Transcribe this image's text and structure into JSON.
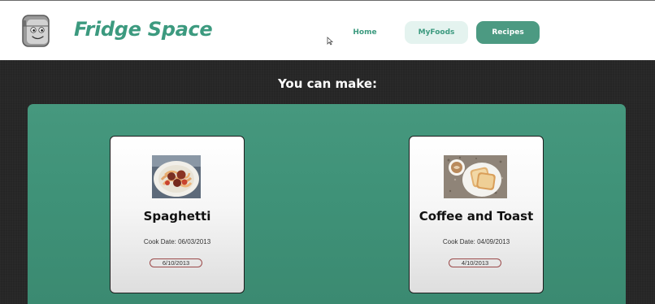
{
  "header": {
    "brand": "Fridge Space",
    "logo_icon": "fridge-mascot-icon",
    "nav": {
      "home": "Home",
      "myfoods": "MyFoods",
      "recipes": "Recipes"
    }
  },
  "main": {
    "headline": "You can make:"
  },
  "recipes": [
    {
      "name": "Spaghetti",
      "cook_date": "Cook Date: 06/03/2013",
      "expiry": "6/10/2013",
      "image_icon": "spaghetti-photo"
    },
    {
      "name": "Coffee and Toast",
      "cook_date": "Cook Date: 04/09/2013",
      "expiry": "4/10/2013",
      "image_icon": "coffee-toast-photo"
    }
  ],
  "colors": {
    "brand": "#3c9a7f",
    "nav_active": "#4c9a82",
    "nav_soft": "#e4f3ef",
    "panel": "#46987e",
    "background": "#272727"
  }
}
